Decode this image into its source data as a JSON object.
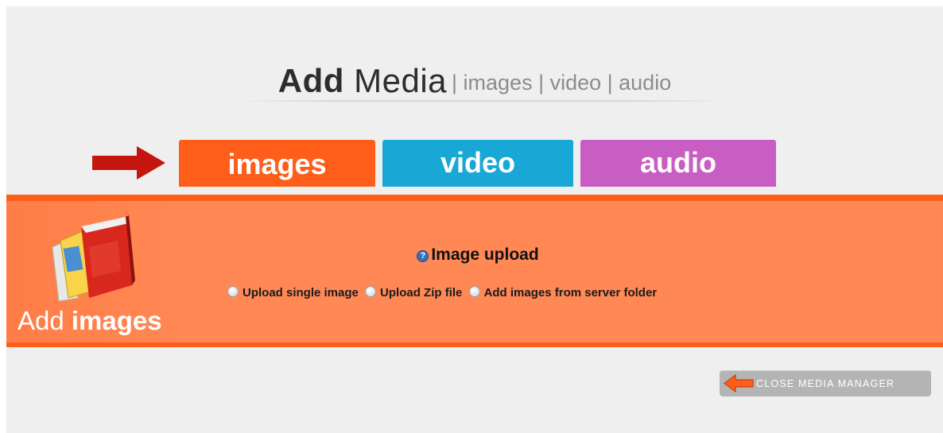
{
  "header": {
    "title_bold": "Add",
    "title_rest": "Media",
    "subtitle": "| images | video | audio"
  },
  "tabs": [
    {
      "label": "images",
      "color": "#ff5e1a",
      "active": true
    },
    {
      "label": "video",
      "color": "#19a8d5",
      "active": false
    },
    {
      "label": "audio",
      "color": "#c85ec3",
      "active": false
    }
  ],
  "panel": {
    "side_label_prefix": "Add",
    "side_label_bold": "images",
    "upload_title": "Image upload",
    "options": [
      {
        "label": "Upload single image",
        "selected": false
      },
      {
        "label": "Upload Zip file",
        "selected": false
      },
      {
        "label": "Add images from server folder",
        "selected": false
      }
    ]
  },
  "close_button": {
    "label": "CLOSE MEDIA MANAGER"
  },
  "icons": {
    "pointer": "red-arrow-right-icon",
    "add_images": "image-book-icon",
    "help": "help-icon",
    "close": "orange-arrow-left-icon"
  },
  "colors": {
    "images": "#ff5e1a",
    "video": "#19a8d5",
    "audio": "#c85ec3",
    "panel": "#ff8855"
  }
}
